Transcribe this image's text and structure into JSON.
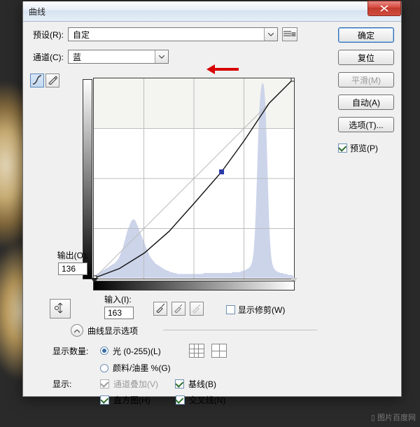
{
  "window": {
    "title": "曲线"
  },
  "preset": {
    "label": "预设(R):",
    "value": "自定"
  },
  "channel": {
    "label": "通道(C):",
    "value": "蓝"
  },
  "output": {
    "label": "输出(O):",
    "value": "136"
  },
  "input": {
    "label": "输入(I):",
    "value": "163"
  },
  "show_clip": {
    "label": "显示修剪(W)"
  },
  "disclosure": {
    "label": "曲线显示选项"
  },
  "display_amount": {
    "label": "显示数量:",
    "opt_light": "光 (0-255)(L)",
    "opt_pigment": "颜料/油墨 %(G)"
  },
  "show": {
    "label": "显示:",
    "channel_overlay": "通道叠加(V)",
    "baseline": "基线(B)",
    "histogram": "直方图(H)",
    "intersection": "交叉线(N)"
  },
  "buttons": {
    "ok": "确定",
    "reset": "复位",
    "smooth": "平滑(M)",
    "auto": "自动(A)",
    "options": "选项(T)..."
  },
  "preview": {
    "label": "预览(P)"
  },
  "chart_data": {
    "type": "line",
    "title": "曲线",
    "xlabel": "输入(I)",
    "ylabel": "输出(O)",
    "xlim": [
      0,
      255
    ],
    "ylim": [
      0,
      255
    ],
    "grid_divisions": 4,
    "curve_points": [
      {
        "x": 0,
        "y": 0
      },
      {
        "x": 32,
        "y": 12
      },
      {
        "x": 64,
        "y": 32
      },
      {
        "x": 96,
        "y": 60
      },
      {
        "x": 128,
        "y": 96
      },
      {
        "x": 163,
        "y": 136
      },
      {
        "x": 192,
        "y": 176
      },
      {
        "x": 224,
        "y": 224
      },
      {
        "x": 255,
        "y": 255
      }
    ],
    "selected_point": {
      "x": 163,
      "y": 136
    },
    "baseline": [
      {
        "x": 0,
        "y": 0
      },
      {
        "x": 255,
        "y": 255
      }
    ],
    "histogram": [
      2,
      3,
      3,
      4,
      4,
      5,
      5,
      6,
      6,
      7,
      7,
      8,
      8,
      9,
      9,
      10,
      10,
      11,
      11,
      12,
      12,
      13,
      13,
      14,
      14,
      15,
      15,
      16,
      17,
      18,
      19,
      20,
      22,
      24,
      26,
      28,
      30,
      33,
      36,
      39,
      42,
      45,
      48,
      50,
      52,
      54,
      56,
      58,
      59,
      60,
      60,
      60,
      59,
      58,
      56,
      54,
      52,
      50,
      48,
      46,
      44,
      42,
      40,
      38,
      36,
      34,
      32,
      30,
      28,
      26,
      24,
      22,
      21,
      20,
      19,
      18,
      17,
      16,
      15,
      14,
      14,
      13,
      13,
      12,
      12,
      11,
      11,
      10,
      10,
      9,
      9,
      8,
      8,
      8,
      7,
      7,
      7,
      6,
      6,
      6,
      6,
      5,
      5,
      5,
      5,
      5,
      4,
      4,
      4,
      4,
      4,
      4,
      4,
      4,
      4,
      4,
      4,
      4,
      4,
      4,
      4,
      4,
      4,
      4,
      4,
      4,
      4,
      4,
      4,
      4,
      4,
      4,
      4,
      4,
      4,
      4,
      4,
      4,
      4,
      4,
      5,
      5,
      5,
      5,
      5,
      5,
      5,
      5,
      5,
      5,
      5,
      5,
      5,
      5,
      5,
      5,
      5,
      5,
      5,
      5,
      5,
      5,
      5,
      5,
      5,
      5,
      5,
      5,
      5,
      5,
      5,
      5,
      5,
      5,
      5,
      5,
      5,
      6,
      6,
      6,
      6,
      6,
      6,
      6,
      6,
      6,
      6,
      6,
      7,
      7,
      7,
      7,
      8,
      8,
      8,
      9,
      9,
      10,
      10,
      11,
      12,
      14,
      16,
      20,
      26,
      36,
      50,
      70,
      95,
      120,
      145,
      165,
      180,
      190,
      196,
      200,
      200,
      198,
      192,
      180,
      162,
      138,
      110,
      82,
      58,
      40,
      28,
      20,
      15,
      12,
      10,
      9,
      8,
      7,
      7,
      6,
      6,
      6,
      5,
      5,
      5,
      5,
      5,
      4,
      4,
      4,
      4,
      4,
      3,
      3,
      3,
      3,
      3,
      3,
      2,
      2
    ]
  }
}
